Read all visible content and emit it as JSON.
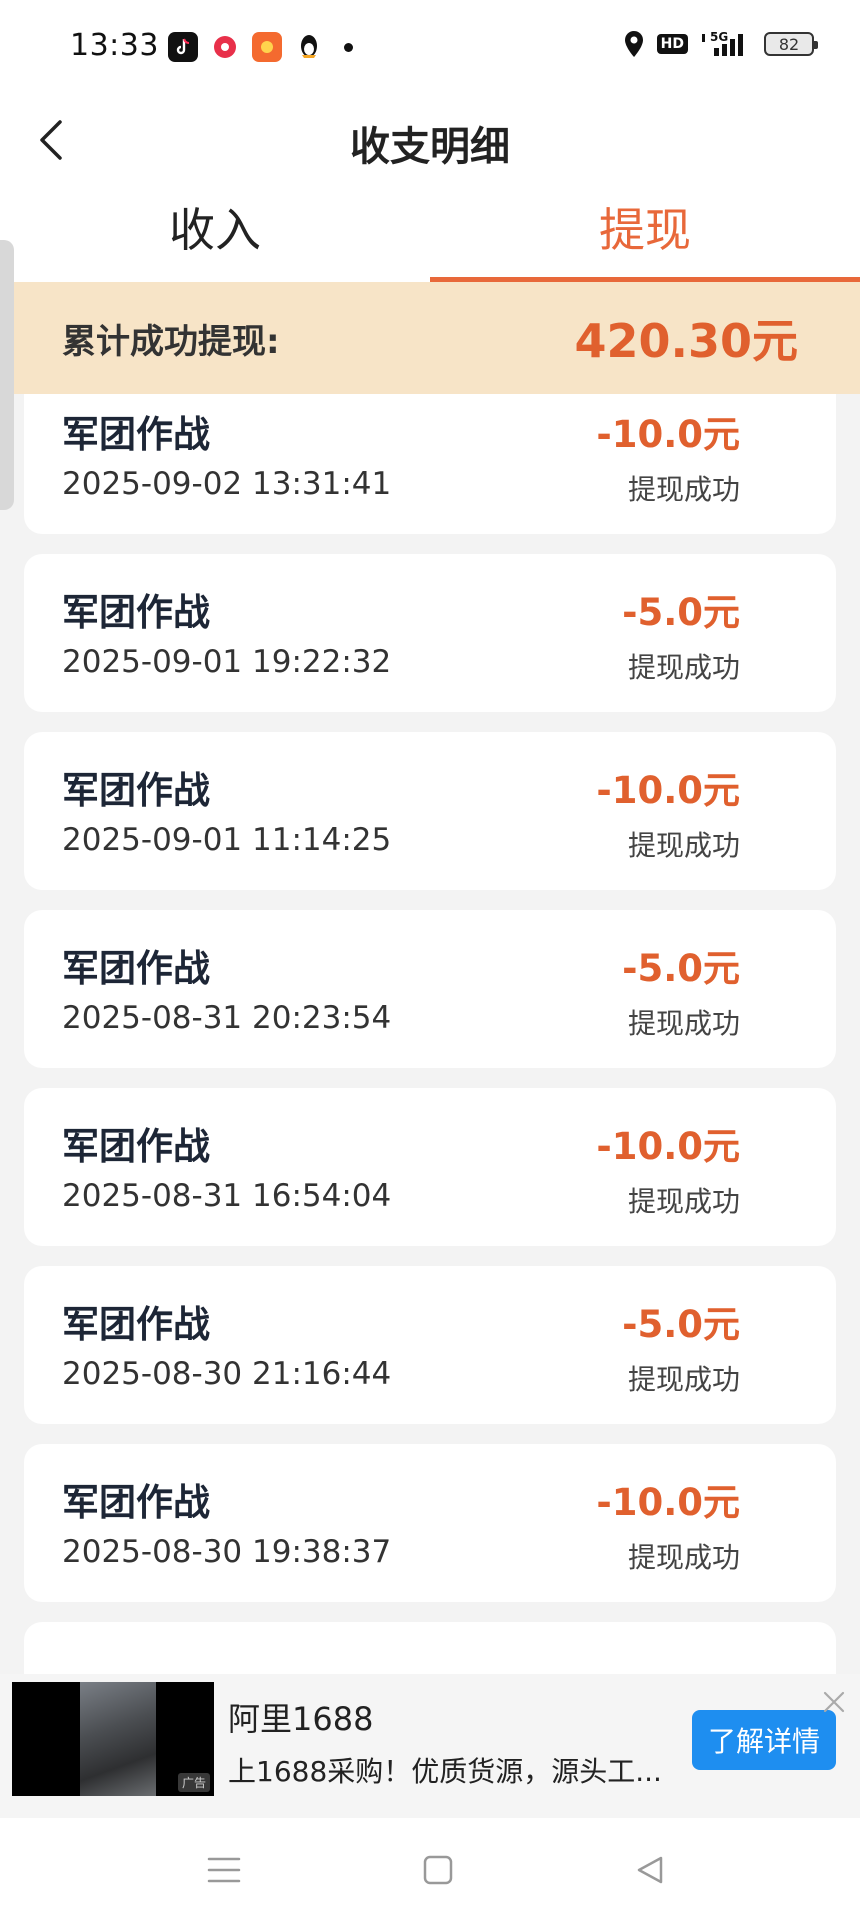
{
  "status_bar": {
    "time": "13:33",
    "apps": [
      "tiktok-icon",
      "red-app-icon",
      "orange-app-icon",
      "qq-penguin-icon"
    ],
    "hd_label": "HD",
    "network": "5G",
    "battery": "82"
  },
  "header": {
    "back_icon": "chevron-left-icon",
    "title": "收支明细"
  },
  "tabs": [
    {
      "label": "收入",
      "active": false
    },
    {
      "label": "提现",
      "active": true
    }
  ],
  "summary": {
    "label": "累计成功提现:",
    "value": "420.30元"
  },
  "records": [
    {
      "title": "军团作战",
      "time": "2025-09-02 13:31:41",
      "amount": "-10.0元",
      "status": "提现成功"
    },
    {
      "title": "军团作战",
      "time": "2025-09-01 19:22:32",
      "amount": "-5.0元",
      "status": "提现成功"
    },
    {
      "title": "军团作战",
      "time": "2025-09-01 11:14:25",
      "amount": "-10.0元",
      "status": "提现成功"
    },
    {
      "title": "军团作战",
      "time": "2025-08-31 20:23:54",
      "amount": "-5.0元",
      "status": "提现成功"
    },
    {
      "title": "军团作战",
      "time": "2025-08-31 16:54:04",
      "amount": "-10.0元",
      "status": "提现成功"
    },
    {
      "title": "军团作战",
      "time": "2025-08-30 21:16:44",
      "amount": "-5.0元",
      "status": "提现成功"
    },
    {
      "title": "军团作战",
      "time": "2025-08-30 19:38:37",
      "amount": "-10.0元",
      "status": "提现成功"
    },
    {
      "title": "",
      "time": "",
      "amount": "",
      "status": ""
    }
  ],
  "ad": {
    "title": "阿里1688",
    "description": "上1688采购！优质货源，源头工...",
    "button": "了解详情",
    "tag": "广告"
  },
  "nav": [
    "menu-icon",
    "home-square-icon",
    "back-triangle-icon"
  ],
  "colors": {
    "accent": "#e8683a",
    "amount": "#e0602e",
    "summary_bg": "#f7e4c7",
    "ad_button": "#1e8ef0"
  }
}
